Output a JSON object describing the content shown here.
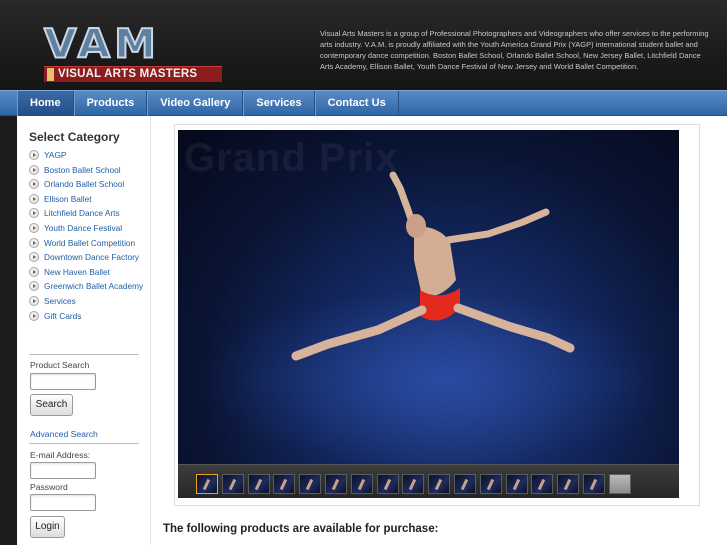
{
  "header": {
    "logo_letters": "VAM",
    "logo_text": "VISUAL ARTS MASTERS",
    "blurb": "Visual Arts Masters is a group of Professional Photographers and Videographers who offer services to the performing arts industry. V.A.M. is proudly affiliated with the Youth America Grand Prix (YAGP) international student ballet and contemporary dance competition. Boston Ballet School, Orlando Ballet School, New Jersey Ballet, Litchfield Dance Arts Academy, Ellison Ballet, Youth Dance Festival of New Jersey and World Ballet Competition."
  },
  "nav": {
    "items": [
      {
        "label": "Home",
        "active": true
      },
      {
        "label": "Products"
      },
      {
        "label": "Video Gallery"
      },
      {
        "label": "Services"
      },
      {
        "label": "Contact Us"
      }
    ]
  },
  "sidebar": {
    "title": "Select Category",
    "categories": [
      "YAGP",
      "Boston Ballet School",
      "Orlando Ballet School",
      "Ellison Ballet",
      "Litchfield Dance Arts",
      "Youth Dance Festival",
      "World Ballet Competition",
      "Downtown Dance Factory",
      "New Haven Ballet",
      "Greenwich Ballet Academy",
      "Services",
      "Gift Cards"
    ],
    "product_search_label": "Product Search",
    "search_button": "Search",
    "advanced_search": "Advanced Search",
    "email_label": "E-mail Address:",
    "password_label": "Password",
    "login_button": "Login"
  },
  "main": {
    "photo_bg_text": "Grand Prix",
    "thumbnail_count": 17,
    "purchase_text": "The following products are available for purchase:"
  },
  "colors": {
    "nav_blue": "#2f66a8",
    "link_blue": "#1f5fa6",
    "logo_red": "#8d1d1d",
    "thumb_active": "#f0a020"
  }
}
